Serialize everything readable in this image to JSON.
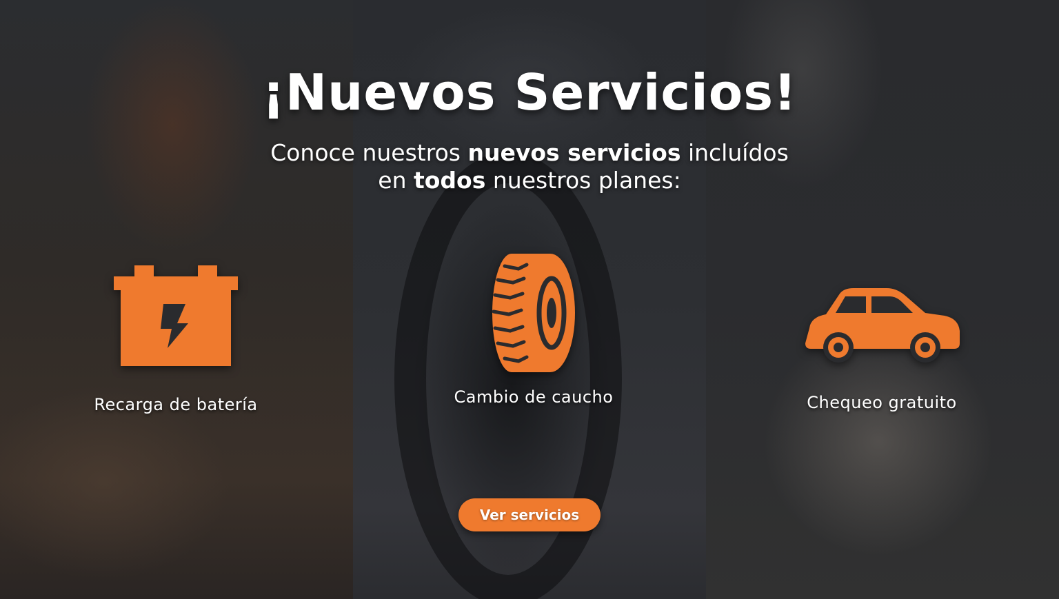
{
  "banner": {
    "title": "¡Nuevos Servicios!",
    "subtitle": {
      "line1_pre": "Conoce nuestros ",
      "line1_bold": "nuevos servicios",
      "line1_post": " incluídos",
      "line2_pre": "en ",
      "line2_bold": "todos",
      "line2_post": " nuestros planes:"
    },
    "accent_color": "#ef7a2e"
  },
  "services": [
    {
      "icon": "battery-icon",
      "label": "Recarga de batería"
    },
    {
      "icon": "tire-icon",
      "label": "Cambio de caucho"
    },
    {
      "icon": "car-icon",
      "label": "Chequeo gratuito"
    }
  ],
  "cta": {
    "label": "Ver servicios"
  }
}
